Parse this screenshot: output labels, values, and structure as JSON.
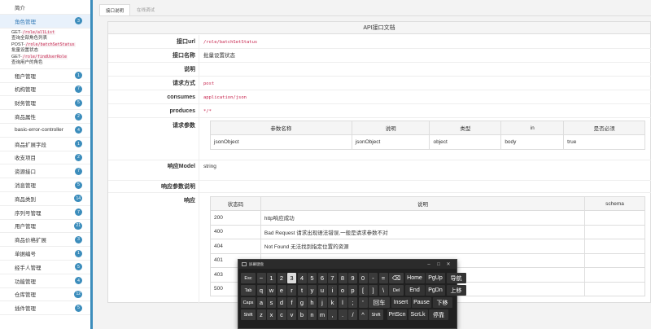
{
  "sidebar": {
    "top": "简介",
    "items_before": [
      {
        "label": "角色管理",
        "count": "3",
        "active": true
      }
    ],
    "sub": [
      {
        "method": "GET-",
        "path": "/role/allList",
        "desc": "查询全部角色列表"
      },
      {
        "method": "POST-",
        "path": "/role/batchSetStatus",
        "desc": "批量设置状态"
      },
      {
        "method": "GET-",
        "path": "/role/findUserRole",
        "desc": "查询用户的角色"
      }
    ],
    "items": [
      {
        "label": "租户管理",
        "count": "1"
      },
      {
        "label": "机构管理",
        "count": "7"
      },
      {
        "label": "财务管理",
        "count": "5"
      },
      {
        "label": "商品属性",
        "count": "2"
      },
      {
        "label": "basic-error-controller",
        "count": "4"
      },
      {
        "label": "商品扩展字段",
        "count": "1"
      },
      {
        "label": "收支项目",
        "count": "2"
      },
      {
        "label": "资源接口",
        "count": "7"
      },
      {
        "label": "消息管理",
        "count": "5"
      },
      {
        "label": "商品类别",
        "count": "14"
      },
      {
        "label": "序列号管理",
        "count": "7"
      },
      {
        "label": "用户管理",
        "count": "21"
      },
      {
        "label": "商品价格扩展",
        "count": "3"
      },
      {
        "label": "单据编号",
        "count": "1"
      },
      {
        "label": "经手人管理",
        "count": "5"
      },
      {
        "label": "功能管理",
        "count": "4"
      },
      {
        "label": "仓库管理",
        "count": "12"
      },
      {
        "label": "插件管理",
        "count": "5"
      }
    ]
  },
  "tabs": [
    "接口说明",
    "在线调试"
  ],
  "doc": {
    "title": "API接口文档",
    "url_label": "接口url",
    "url": "/role/batchSetStatus",
    "name_label": "接口名称",
    "name": "批量设置状态",
    "desc_label": "说明",
    "desc": "",
    "method_label": "请求方式",
    "method": "post",
    "consumes_label": "consumes",
    "consumes": "application/json",
    "produces_label": "produces",
    "produces": "*/*",
    "params_label": "请求参数",
    "params_head": [
      "参数名称",
      "说明",
      "类型",
      "in",
      "是否必须"
    ],
    "params_rows": [
      [
        "jsonObject",
        "jsonObject",
        "object",
        "body",
        "true"
      ]
    ],
    "model_label": "响应Model",
    "model": "string",
    "resp_params_label": "响应参数说明",
    "resp_label": "响应",
    "resp_head": [
      "状态码",
      "说明",
      "schema"
    ],
    "resp_rows": [
      [
        "200",
        "http响应成功",
        ""
      ],
      [
        "400",
        "Bad Request 请求出现语法错误,一般是请求参数不对",
        ""
      ],
      [
        "404",
        "Not Found 无法找到指定位置的资源",
        ""
      ],
      [
        "401",
        "",
        ""
      ],
      [
        "403",
        "",
        ""
      ],
      [
        "500",
        "",
        ""
      ]
    ]
  },
  "osk": {
    "title": "屏幕键盘",
    "rows": [
      [
        "Esc",
        "~",
        "1",
        "2",
        "3",
        "4",
        "5",
        "6",
        "7",
        "8",
        "9",
        "0",
        "-",
        "=",
        "⌫",
        "Home",
        "PgUp",
        "导航"
      ],
      [
        "Tab",
        "q",
        "w",
        "e",
        "r",
        "t",
        "y",
        "u",
        "i",
        "o",
        "p",
        "[",
        "]",
        "\\",
        "Del",
        "End",
        "PgDn",
        "上移"
      ],
      [
        "Caps",
        "a",
        "s",
        "d",
        "f",
        "g",
        "h",
        "j",
        "k",
        "l",
        ";",
        "'",
        "回车",
        "Insert",
        "Pause",
        "下移"
      ],
      [
        "Shift",
        "z",
        "x",
        "c",
        "v",
        "b",
        "n",
        "m",
        ",",
        ".",
        "/",
        "^",
        "Shift",
        "PrtScn",
        "ScrLk",
        "停靠"
      ]
    ]
  }
}
